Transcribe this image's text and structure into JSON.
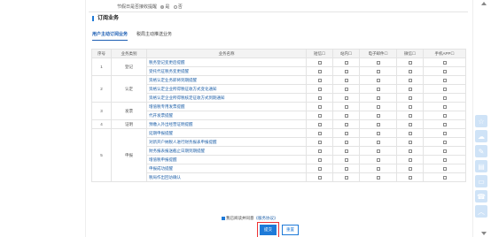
{
  "top_row": {
    "label": "节假日是否接收提醒",
    "opt_yes": "是",
    "opt_no": "否"
  },
  "section_title": "订阅业务",
  "tabs": [
    {
      "label": "用户主动订阅业务"
    },
    {
      "label": "税局主动推送业务"
    }
  ],
  "table": {
    "headers": {
      "no": "序号",
      "category": "业务类别",
      "name": "业务名称",
      "sms": "短信☐",
      "station": "站内☐",
      "email": "电子邮件☐",
      "wechat": "微信☐",
      "app": "手机APP☐"
    },
    "groups": [
      {
        "no": "1",
        "category": "登记",
        "items": [
          "税务登记变更后提醒",
          "受托代征税务变更提醒"
        ]
      },
      {
        "no": "2",
        "category": "认定",
        "items": [
          "资格认定业务即将到期提醒",
          "资格认定企业所得税征收方式变化通知",
          "资格认定企业所得税核定征收方式到期通知"
        ]
      },
      {
        "no": "3",
        "category": "发票",
        "items": [
          "增值税专用发票提醒",
          "代开发票提醒"
        ]
      },
      {
        "no": "4",
        "category": "证明",
        "items": [
          "预缴入外出经营证明提醒"
        ]
      },
      {
        "no": "5",
        "category": "申报",
        "items": [
          "延期申报提醒",
          "对新开户纳税人进行财务报表申报提醒",
          "财务报表报送截止日期到期提醒",
          "增值税申报提醒",
          "申报成功提醒",
          "税局作出回访确认"
        ]
      }
    ]
  },
  "agreement": {
    "prefix": "我已阅读并同意",
    "link": "《服务协议》"
  },
  "buttons": {
    "submit": "提交",
    "reset": "重置"
  },
  "colors": {
    "accent": "#1e7ad8",
    "highlight": "#e33333"
  },
  "float_icons": [
    "star-icon",
    "cloud-icon",
    "paint-icon",
    "document-icon",
    "card-icon",
    "phone-icon",
    "chevron-up-icon"
  ]
}
